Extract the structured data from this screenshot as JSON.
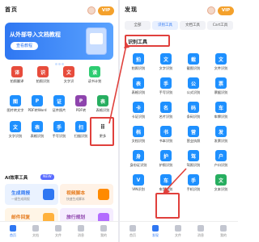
{
  "left": {
    "header": {
      "title": "首页",
      "vip": "VIP"
    },
    "banner": {
      "title": "从外部导入文档教程",
      "button": "查看教程"
    },
    "grid": [
      {
        "label": "拍照翻译",
        "color": "#e74c3c",
        "glyph": "译"
      },
      {
        "label": "拍照识别",
        "color": "#e74c3c",
        "glyph": "识"
      },
      {
        "label": "文字识",
        "color": "#e74c3c",
        "glyph": "文"
      },
      {
        "label": "读书计划",
        "color": "#2ecc71",
        "glyph": "读"
      },
      {
        "label": "图片转文字",
        "color": "#1e90ff",
        "glyph": "图"
      },
      {
        "label": "PDF转Word",
        "color": "#1e90ff",
        "glyph": "P"
      },
      {
        "label": "证件照片",
        "color": "#1e90ff",
        "glyph": "证"
      },
      {
        "label": "PDF转",
        "color": "#8e44ad",
        "glyph": "P"
      },
      {
        "label": "表格识别",
        "color": "#27ae60",
        "glyph": "表"
      },
      {
        "label": "文字识别",
        "color": "#1e90ff",
        "glyph": "文"
      },
      {
        "label": "表格识别",
        "color": "#1e90ff",
        "glyph": "表"
      },
      {
        "label": "手写识别",
        "color": "#1e90ff",
        "glyph": "手"
      },
      {
        "label": "扫描识别",
        "color": "#1e90ff",
        "glyph": "扫"
      },
      {
        "label": "更多",
        "color": "#ffffff",
        "glyph": "⠿"
      }
    ],
    "ai_tools": {
      "title": "AI效率工具",
      "tag": "NEW",
      "cards": [
        {
          "title": "生成周报",
          "subtitle": "一键生成周报",
          "bg": "#eaf2ff",
          "fg": "#2f77f2",
          "icon": "#2f77f2"
        },
        {
          "title": "视频脚本",
          "subtitle": "快速生成脚本",
          "bg": "#fff2e6",
          "fg": "#e67e22",
          "icon": "#ff8a00"
        },
        {
          "title": "邮件回复",
          "subtitle": "智能回复邮件",
          "bg": "#fff5e6",
          "fg": "#e67e22",
          "icon": "#ffb13b"
        },
        {
          "title": "旅行规划",
          "subtitle": "一键规划行程",
          "bg": "#f5ecff",
          "fg": "#8e44ad",
          "icon": "#b36cff"
        }
      ]
    },
    "tabbar": [
      {
        "label": "首页",
        "active": true
      },
      {
        "label": "文档",
        "active": false
      },
      {
        "label": "文件",
        "active": false
      },
      {
        "label": "消息",
        "active": false
      },
      {
        "label": "我的",
        "active": false
      }
    ]
  },
  "right": {
    "header": {
      "title": "发现",
      "vip": "VIP"
    },
    "tabs": [
      "全部",
      "识别工具",
      "文档工具",
      "Cart工具"
    ],
    "section_title": "识别工具",
    "grid": [
      {
        "label": "拍照识别",
        "color": "#1e90ff",
        "glyph": "拍"
      },
      {
        "label": "文字识别",
        "color": "#1e90ff",
        "glyph": "文"
      },
      {
        "label": "截图识别",
        "color": "#1e90ff",
        "glyph": "截"
      },
      {
        "label": "文件识别",
        "color": "#1e90ff",
        "glyph": "文"
      },
      {
        "label": "表格识别",
        "color": "#1e90ff",
        "glyph": "表"
      },
      {
        "label": "手写识别",
        "color": "#1e90ff",
        "glyph": "手"
      },
      {
        "label": "公式识别",
        "color": "#1e90ff",
        "glyph": "公"
      },
      {
        "label": "票据识别",
        "color": "#1e90ff",
        "glyph": "票"
      },
      {
        "label": "卡证识别",
        "color": "#1e90ff",
        "glyph": "卡"
      },
      {
        "label": "名片识别",
        "color": "#1e90ff",
        "glyph": "名"
      },
      {
        "label": "条码识别",
        "color": "#1e90ff",
        "glyph": "码"
      },
      {
        "label": "车牌识别",
        "color": "#1e90ff",
        "glyph": "车"
      },
      {
        "label": "文档识别",
        "color": "#1e90ff",
        "glyph": "档"
      },
      {
        "label": "书本识别",
        "color": "#1e90ff",
        "glyph": "书"
      },
      {
        "label": "营业执照",
        "color": "#1e90ff",
        "glyph": "营"
      },
      {
        "label": "发票识别",
        "color": "#1e90ff",
        "glyph": "发"
      },
      {
        "label": "身份证识别",
        "color": "#1e90ff",
        "glyph": "身"
      },
      {
        "label": "护照识别",
        "color": "#1e90ff",
        "glyph": "护"
      },
      {
        "label": "驾照识别",
        "color": "#1e90ff",
        "glyph": "驾"
      },
      {
        "label": "户口识别",
        "color": "#1e90ff",
        "glyph": "户"
      },
      {
        "label": "VIN识别",
        "color": "#1e90ff",
        "glyph": "V"
      },
      {
        "label": "车型识别",
        "color": "#1e90ff",
        "glyph": "车"
      },
      {
        "label": "手机识别",
        "color": "#1e90ff",
        "glyph": "手"
      },
      {
        "label": "文本识别",
        "color": "#27ae60",
        "glyph": "文"
      }
    ],
    "tabbar": [
      {
        "label": "首页",
        "active": false
      },
      {
        "label": "发现",
        "active": true
      },
      {
        "label": "文件",
        "active": false
      },
      {
        "label": "消息",
        "active": false
      },
      {
        "label": "我的",
        "active": false
      }
    ]
  }
}
